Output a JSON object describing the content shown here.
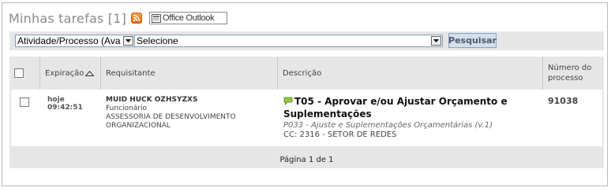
{
  "header": {
    "title": "Minhas tarefas [1]",
    "outlook_label": "Office Outlook"
  },
  "filters": {
    "activity_select_value": "Atividade/Processo (Ava",
    "option_select_value": "Selecione",
    "search_button": "Pesquisar"
  },
  "table": {
    "columns": {
      "expiration": "Expiração",
      "requester": "Requisitante",
      "description": "Descrição",
      "process_number": "Número do processo"
    },
    "rows": [
      {
        "expiration_day": "hoje",
        "expiration_time": "09:42:51",
        "requester_name": "MUID HUCK OZHSYZXS",
        "requester_role": "Funcionário",
        "requester_dept": "ASSESSORIA DE DESENVOLVIMENTO ORGANIZACIONAL",
        "task_title": "T05 - Aprovar e/ou Ajustar Orçamento e Suplementações",
        "process_name": "P033 - Ajuste e Suplementações Orçamentárias (v.1)",
        "cost_center": "CC: 2316 - SETOR DE REDES",
        "process_number": "91038"
      }
    ],
    "pagination": "Página 1 de 1"
  },
  "colors": {
    "accent_button_bg": "#d5dfea",
    "bar_bg": "#e6e6e6",
    "rss": "#e8650f"
  }
}
